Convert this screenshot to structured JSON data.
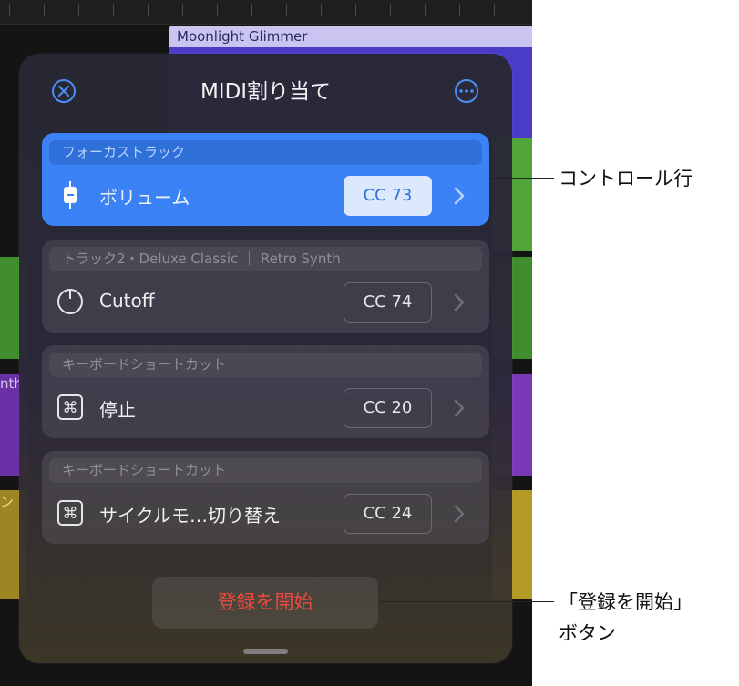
{
  "background": {
    "region_name": "Moonlight Glimmer",
    "left_label_1": "nth",
    "left_label_2": "ン"
  },
  "popover": {
    "title": "MIDI割り当て",
    "close_icon": "close-circle-icon",
    "more_icon": "ellipsis-circle-icon",
    "rows": [
      {
        "section": "フォーカストラック",
        "icon": "fader-icon",
        "label": "ボリューム",
        "cc": "CC 73",
        "selected": true
      },
      {
        "section": "トラック2・Deluxe Classic ｜ Retro Synth",
        "icon": "knob-icon",
        "label": "Cutoff",
        "cc": "CC 74",
        "selected": false
      },
      {
        "section": "キーボードショートカット",
        "icon": "command-key-icon",
        "label": "停止",
        "cc": "CC 20",
        "selected": false
      },
      {
        "section": "キーボードショートカット",
        "icon": "command-key-icon",
        "label": "サイクルモ…切り替え",
        "cc": "CC 24",
        "selected": false
      }
    ],
    "start_button_label": "登録を開始"
  },
  "callouts": {
    "control_row": "コントロール行",
    "start_button_line1": "「登録を開始」",
    "start_button_line2": "ボタン"
  },
  "colors": {
    "accent": "#3b82f6",
    "destructive_text": "#f04a3e"
  }
}
